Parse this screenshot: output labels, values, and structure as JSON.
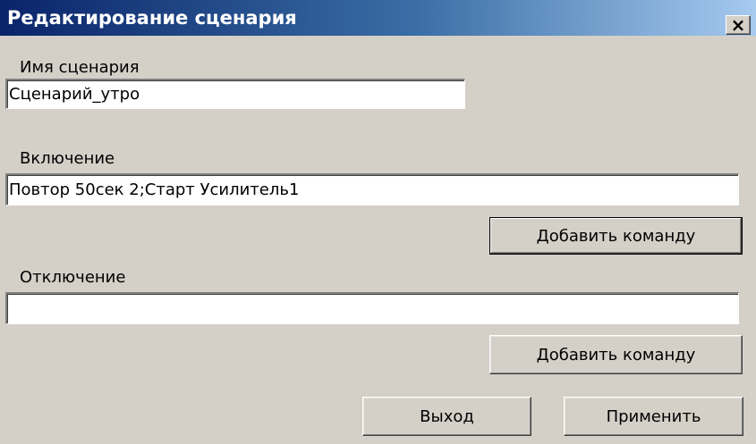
{
  "window": {
    "title": "Редактирование сценария",
    "close_label": "×"
  },
  "name_section": {
    "label": "Имя сценария",
    "value": "Сценарий_утро"
  },
  "enable_section": {
    "label": "Включение",
    "value": "Повтор 50сек 2;Старт Усилитель1",
    "add_label": "Добавить команду"
  },
  "disable_section": {
    "label": "Отключение",
    "value": "",
    "add_label": "Добавить команду"
  },
  "footer": {
    "exit_label": "Выход",
    "apply_label": "Применить"
  },
  "colors": {
    "title_start": "#0a246a",
    "title_end": "#a6caf0",
    "dialog_bg": "#d4d0c8"
  },
  "icons": {
    "close": "close-icon"
  }
}
